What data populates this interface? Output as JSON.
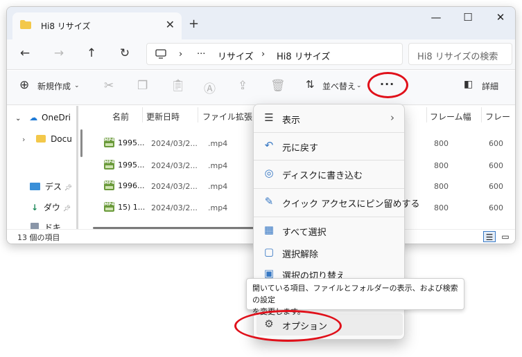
{
  "window": {
    "tab_title": "Hi8 リサイズ",
    "tab_close": "✕",
    "new_tab": "+",
    "minimize": "—",
    "maximize": "☐",
    "close": "✕"
  },
  "nav": {
    "back": "←",
    "forward": "→",
    "up": "↑",
    "refresh": "↻"
  },
  "address": {
    "overflow": "···",
    "segments": [
      "リサイズ",
      "Hi8 リサイズ"
    ],
    "separator": "›",
    "search_placeholder": "Hi8 リサイズの検索"
  },
  "toolbar": {
    "new_label": "新規作成",
    "sort_label": "並べ替え",
    "more_label": "···",
    "details_label": "詳細"
  },
  "sidebar": {
    "items": [
      {
        "label": "OneDri",
        "icon": "cloud-icon"
      },
      {
        "label": "Docu",
        "icon": "folder-icon"
      },
      {
        "label": "デス",
        "icon": "desktop-icon"
      },
      {
        "label": "ダウ",
        "icon": "download-icon"
      },
      {
        "label": "ドキ",
        "icon": "document-icon"
      }
    ]
  },
  "files": {
    "headers": [
      "名前",
      "更新日時",
      "ファイル拡張...",
      "フレーム幅",
      "フレー"
    ],
    "rows": [
      {
        "name": "1995...",
        "date": "2024/03/2...",
        "ext": ".mp4",
        "width": "800",
        "height": "600"
      },
      {
        "name": "1995...",
        "date": "2024/03/2...",
        "ext": ".mp4",
        "width": "800",
        "height": "600"
      },
      {
        "name": "1996...",
        "date": "2024/03/2...",
        "ext": ".mp4",
        "width": "800",
        "height": "600"
      },
      {
        "name": "15) 1...",
        "date": "2024/03/2...",
        "ext": ".mp4",
        "width": "800",
        "height": "600"
      }
    ],
    "icon_label": "MP4"
  },
  "status": {
    "count": "13 個の項目"
  },
  "menu": {
    "items": [
      {
        "label": "表示",
        "icon": "view-icon",
        "glyph": "☰",
        "submenu": "›"
      },
      {
        "label": "元に戻す",
        "icon": "undo-icon",
        "glyph": "↶"
      },
      {
        "label": "ディスクに書き込む",
        "icon": "disc-icon",
        "glyph": "◎"
      },
      {
        "label": "クイック アクセスにピン留めする",
        "icon": "pin-icon",
        "glyph": "✎"
      },
      {
        "label": "すべて選択",
        "icon": "select-all-icon",
        "glyph": "▦"
      },
      {
        "label": "選択解除",
        "icon": "select-none-icon",
        "glyph": "▢"
      },
      {
        "label": "選択の切り替え",
        "icon": "invert-selection-icon",
        "glyph": "▣"
      },
      {
        "label": "オプション",
        "icon": "options-gear-icon",
        "glyph": "⚙"
      }
    ]
  },
  "tooltip": {
    "line1": "開いている項目、ファイルとフォルダーの表示、および検索の設定",
    "line2": "を変更します。"
  },
  "colors": {
    "annotation_red": "#e0101a",
    "accent_blue": "#3778c4",
    "folder_yellow": "#f3c84a"
  }
}
